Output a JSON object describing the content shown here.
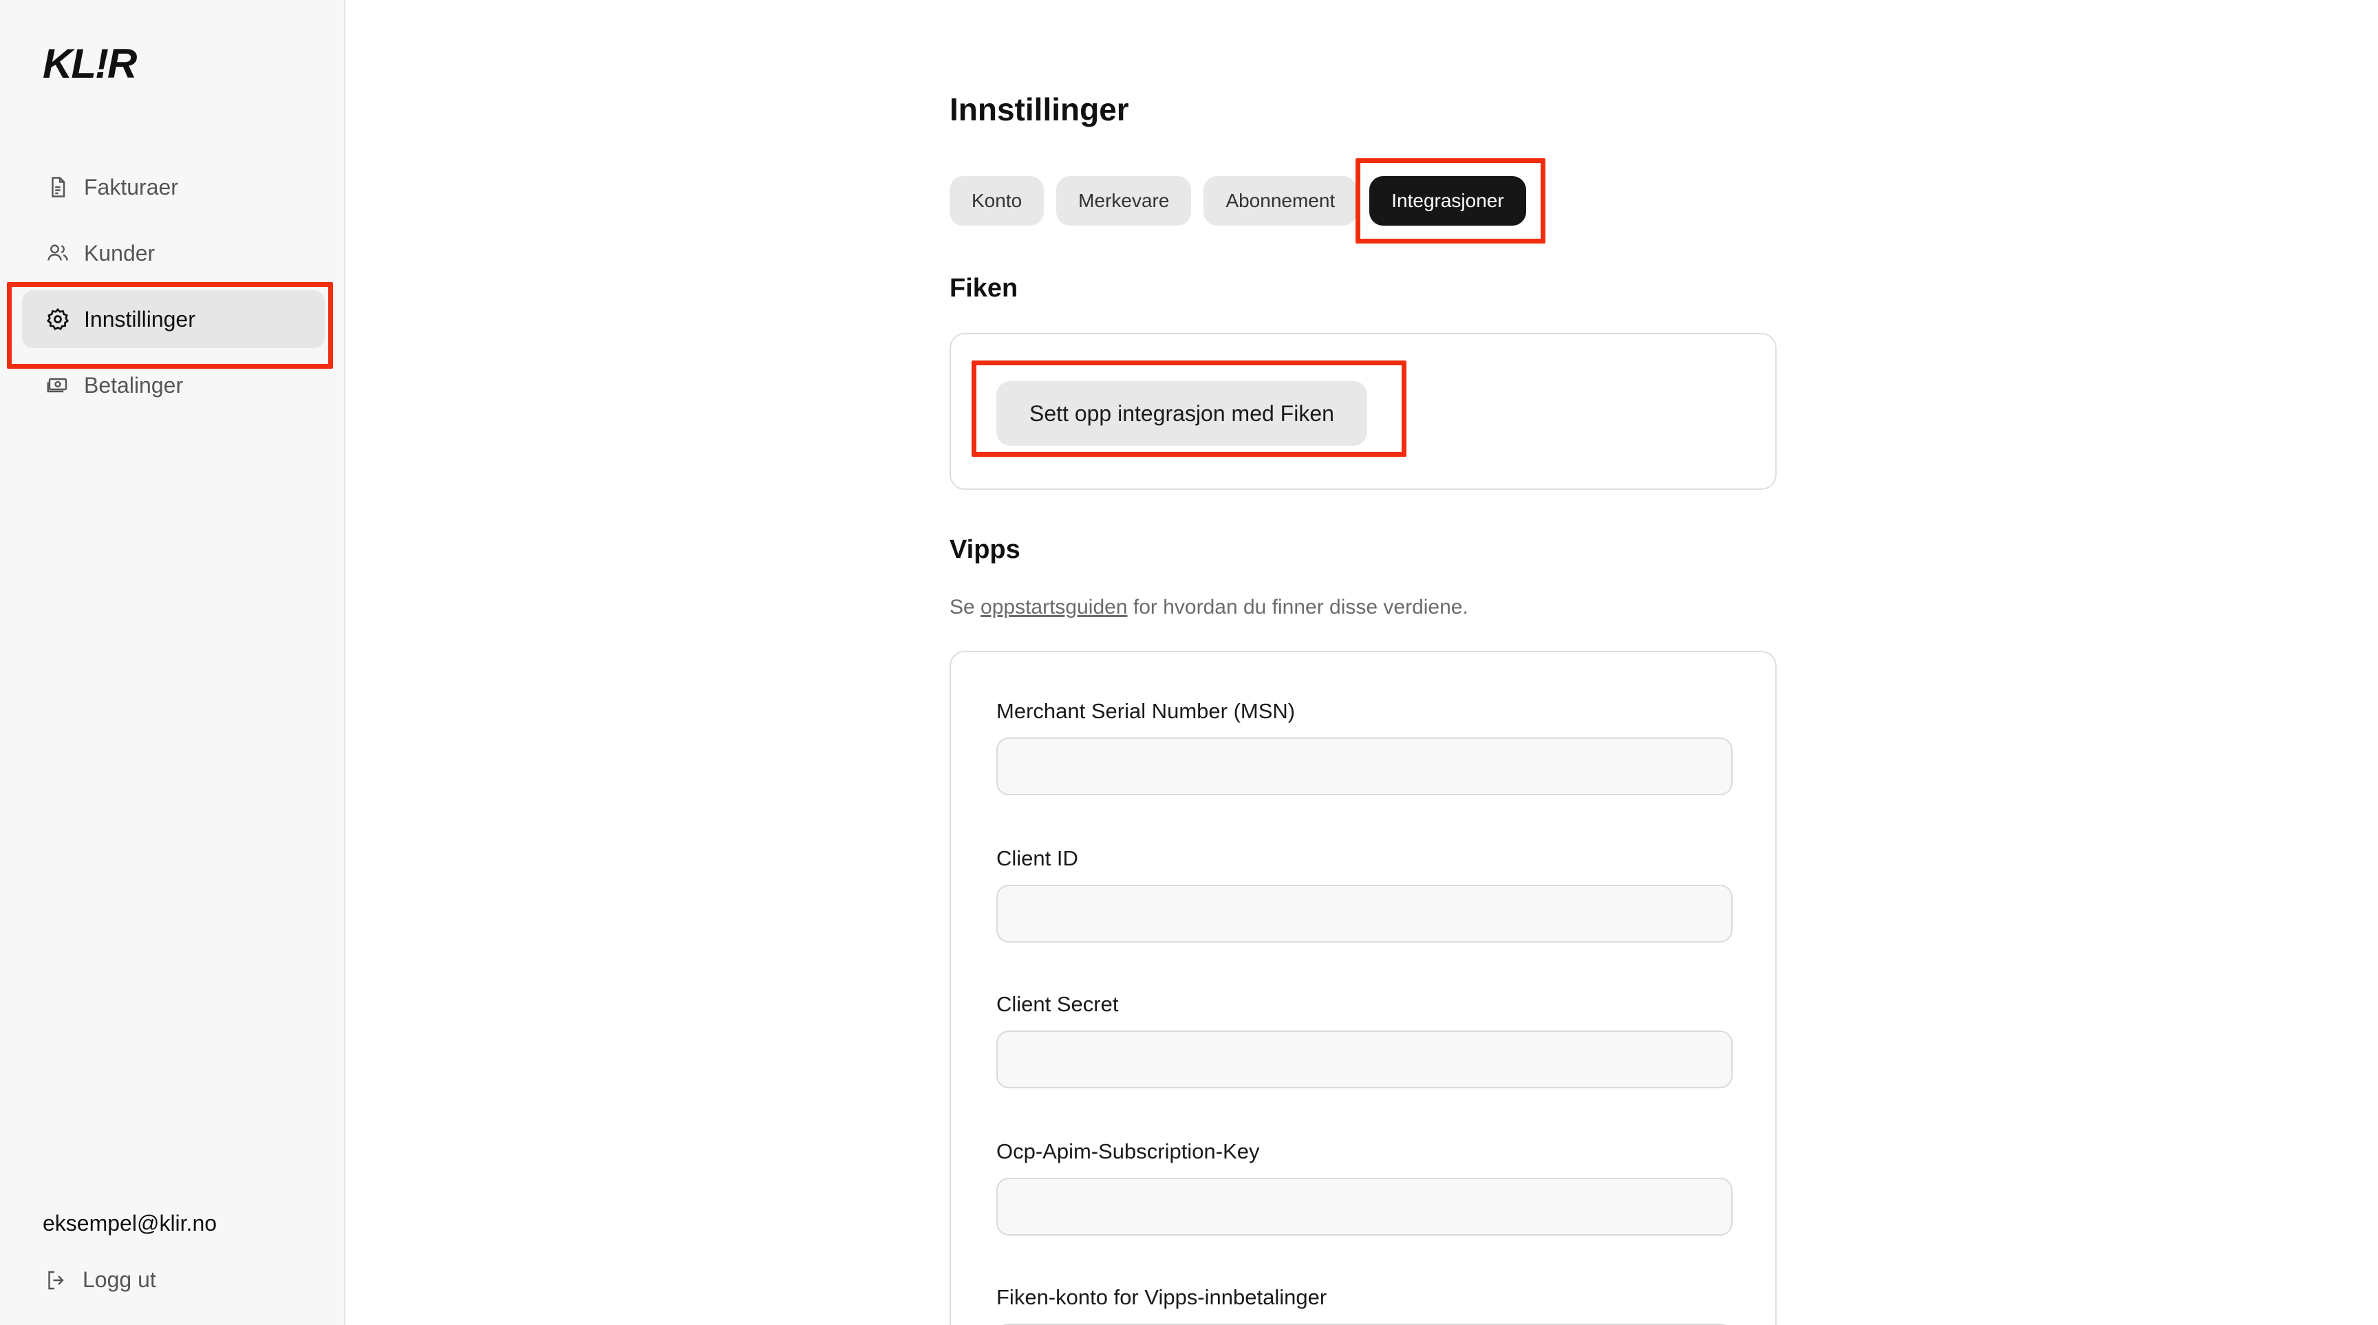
{
  "brand": {
    "logo": "KL!R"
  },
  "sidebar": {
    "items": [
      {
        "label": "Fakturaer",
        "icon": "document-icon"
      },
      {
        "label": "Kunder",
        "icon": "users-icon"
      },
      {
        "label": "Innstillinger",
        "icon": "gear-icon",
        "active": true
      },
      {
        "label": "Betalinger",
        "icon": "banknote-icon"
      }
    ],
    "user_email": "eksempel@klir.no",
    "logout_label": "Logg ut"
  },
  "main": {
    "title": "Innstillinger",
    "tabs": [
      {
        "label": "Konto"
      },
      {
        "label": "Merkevare"
      },
      {
        "label": "Abonnement"
      },
      {
        "label": "Integrasjoner",
        "active": true
      }
    ],
    "fiken": {
      "title": "Fiken",
      "setup_button": "Sett opp integrasjon med Fiken"
    },
    "vipps": {
      "title": "Vipps",
      "desc_prefix": "Se ",
      "desc_link": "oppstartsguiden",
      "desc_suffix": " for hvordan du finner disse verdiene.",
      "fields": [
        {
          "label": "Merchant Serial Number (MSN)",
          "value": ""
        },
        {
          "label": "Client ID",
          "value": ""
        },
        {
          "label": "Client Secret",
          "value": ""
        },
        {
          "label": "Ocp-Apim-Subscription-Key",
          "value": ""
        },
        {
          "label": "Fiken-konto for Vipps-innbetalinger",
          "value": ""
        }
      ]
    }
  },
  "colors": {
    "highlight": "#f02e0f",
    "active_tab": "#161616",
    "sidebar_bg": "#f7f7f7"
  }
}
